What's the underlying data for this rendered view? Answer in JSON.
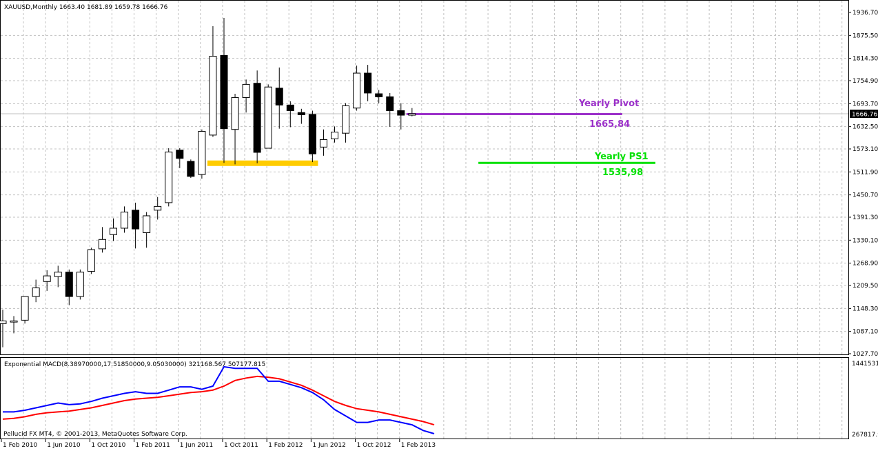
{
  "header": {
    "symbol_line": "XAUUSD,Monthly  1663.40 1681.89 1659.78 1666.76"
  },
  "indicator": {
    "label": "Exponential MACD(8.38970000,17.51850000,9.05030000) 321168.567 507177.815",
    "scale_top": "1441531.",
    "scale_bottom": "267817.9"
  },
  "footer": {
    "copyright": "Pellucid FX MT4, © 2001-2013, MetaQuotes Software Corp."
  },
  "current_price": "1666.76",
  "annotations": {
    "pivot_label": "Yearly Pivot",
    "pivot_value": "1665,84",
    "ps1_label": "Yearly PS1",
    "ps1_value": "1535,98"
  },
  "colors": {
    "bull_body": "#ffffff",
    "bear_body": "#000000",
    "grid": "#c0c0c0",
    "pivot": "#9b30c9",
    "ps1": "#00e000",
    "support_band": "#ffcc00",
    "macd_line": "#0000ff",
    "signal_line": "#ff0000"
  },
  "chart_data": {
    "type": "candlestick",
    "symbol": "XAUUSD",
    "timeframe": "Monthly",
    "y_ticks": [
      "1936.70",
      "1875.50",
      "1814.30",
      "1754.90",
      "1693.70",
      "1632.50",
      "1573.10",
      "1511.90",
      "1450.70",
      "1391.30",
      "1330.10",
      "1268.90",
      "1209.50",
      "1148.30",
      "1087.10",
      "1027.70"
    ],
    "x_ticks": [
      "1 Feb 2010",
      "1 Jun 2010",
      "1 Oct 2010",
      "1 Feb 2011",
      "1 Jun 2011",
      "1 Oct 2011",
      "1 Feb 2012",
      "1 Jun 2012",
      "1 Oct 2012",
      "1 Feb 2013"
    ],
    "ylim": [
      1027.7,
      1936.7
    ],
    "candles": [
      {
        "o": 1108,
        "h": 1145,
        "l": 1045,
        "c": 1115
      },
      {
        "o": 1112,
        "h": 1128,
        "l": 1082,
        "c": 1115
      },
      {
        "o": 1117,
        "h": 1180,
        "l": 1108,
        "c": 1180
      },
      {
        "o": 1180,
        "h": 1225,
        "l": 1165,
        "c": 1203
      },
      {
        "o": 1220,
        "h": 1250,
        "l": 1195,
        "c": 1235
      },
      {
        "o": 1233,
        "h": 1262,
        "l": 1205,
        "c": 1245
      },
      {
        "o": 1245,
        "h": 1252,
        "l": 1157,
        "c": 1180
      },
      {
        "o": 1180,
        "h": 1252,
        "l": 1172,
        "c": 1245
      },
      {
        "o": 1247,
        "h": 1310,
        "l": 1240,
        "c": 1305
      },
      {
        "o": 1307,
        "h": 1365,
        "l": 1297,
        "c": 1332
      },
      {
        "o": 1345,
        "h": 1388,
        "l": 1328,
        "c": 1362
      },
      {
        "o": 1362,
        "h": 1420,
        "l": 1350,
        "c": 1405
      },
      {
        "o": 1410,
        "h": 1430,
        "l": 1308,
        "c": 1360
      },
      {
        "o": 1350,
        "h": 1405,
        "l": 1310,
        "c": 1395
      },
      {
        "o": 1410,
        "h": 1445,
        "l": 1385,
        "c": 1420
      },
      {
        "o": 1430,
        "h": 1575,
        "l": 1420,
        "c": 1565
      },
      {
        "o": 1570,
        "h": 1575,
        "l": 1522,
        "c": 1548
      },
      {
        "o": 1540,
        "h": 1545,
        "l": 1496,
        "c": 1500
      },
      {
        "o": 1505,
        "h": 1625,
        "l": 1494,
        "c": 1620
      },
      {
        "o": 1610,
        "h": 1900,
        "l": 1605,
        "c": 1820
      },
      {
        "o": 1822,
        "h": 1922,
        "l": 1536,
        "c": 1627
      },
      {
        "o": 1625,
        "h": 1720,
        "l": 1532,
        "c": 1710
      },
      {
        "o": 1710,
        "h": 1758,
        "l": 1670,
        "c": 1745
      },
      {
        "o": 1748,
        "h": 1782,
        "l": 1535,
        "c": 1564
      },
      {
        "o": 1575,
        "h": 1745,
        "l": 1575,
        "c": 1738
      },
      {
        "o": 1735,
        "h": 1790,
        "l": 1627,
        "c": 1690
      },
      {
        "o": 1690,
        "h": 1700,
        "l": 1631,
        "c": 1675
      },
      {
        "o": 1670,
        "h": 1680,
        "l": 1640,
        "c": 1664
      },
      {
        "o": 1665,
        "h": 1675,
        "l": 1538,
        "c": 1560
      },
      {
        "o": 1578,
        "h": 1625,
        "l": 1555,
        "c": 1598
      },
      {
        "o": 1600,
        "h": 1633,
        "l": 1590,
        "c": 1618
      },
      {
        "o": 1615,
        "h": 1695,
        "l": 1590,
        "c": 1688
      },
      {
        "o": 1682,
        "h": 1795,
        "l": 1675,
        "c": 1775
      },
      {
        "o": 1775,
        "h": 1797,
        "l": 1700,
        "c": 1722
      },
      {
        "o": 1720,
        "h": 1730,
        "l": 1695,
        "c": 1712
      },
      {
        "o": 1712,
        "h": 1722,
        "l": 1632,
        "c": 1675
      },
      {
        "o": 1675,
        "h": 1695,
        "l": 1625,
        "c": 1663
      },
      {
        "o": 1663,
        "h": 1682,
        "l": 1660,
        "c": 1667
      }
    ],
    "levels": [
      {
        "name": "Yearly Pivot",
        "value": 1665.84,
        "from_index": 36.5,
        "to_index": 56
      },
      {
        "name": "Yearly PS1",
        "value": 1535.98,
        "from_index": 43,
        "to_index": 59
      }
    ],
    "support_zone": {
      "value": 1535,
      "from_index": 18.5,
      "to_index": 28.5
    },
    "macd": {
      "macd_line": [
        0.33,
        0.33,
        0.35,
        0.38,
        0.41,
        0.44,
        0.42,
        0.43,
        0.46,
        0.5,
        0.53,
        0.56,
        0.58,
        0.56,
        0.56,
        0.6,
        0.64,
        0.64,
        0.61,
        0.65,
        0.89,
        0.87,
        0.87,
        0.87,
        0.71,
        0.71,
        0.67,
        0.63,
        0.57,
        0.48,
        0.36,
        0.28,
        0.2,
        0.2,
        0.23,
        0.23,
        0.2,
        0.17,
        0.1,
        0.06
      ],
      "signal_line": [
        0.24,
        0.25,
        0.27,
        0.3,
        0.32,
        0.33,
        0.34,
        0.36,
        0.38,
        0.41,
        0.44,
        0.47,
        0.49,
        0.5,
        0.51,
        0.53,
        0.55,
        0.57,
        0.58,
        0.6,
        0.65,
        0.72,
        0.75,
        0.77,
        0.76,
        0.74,
        0.7,
        0.66,
        0.6,
        0.53,
        0.46,
        0.41,
        0.37,
        0.35,
        0.33,
        0.3,
        0.27,
        0.24,
        0.21,
        0.17
      ]
    }
  }
}
